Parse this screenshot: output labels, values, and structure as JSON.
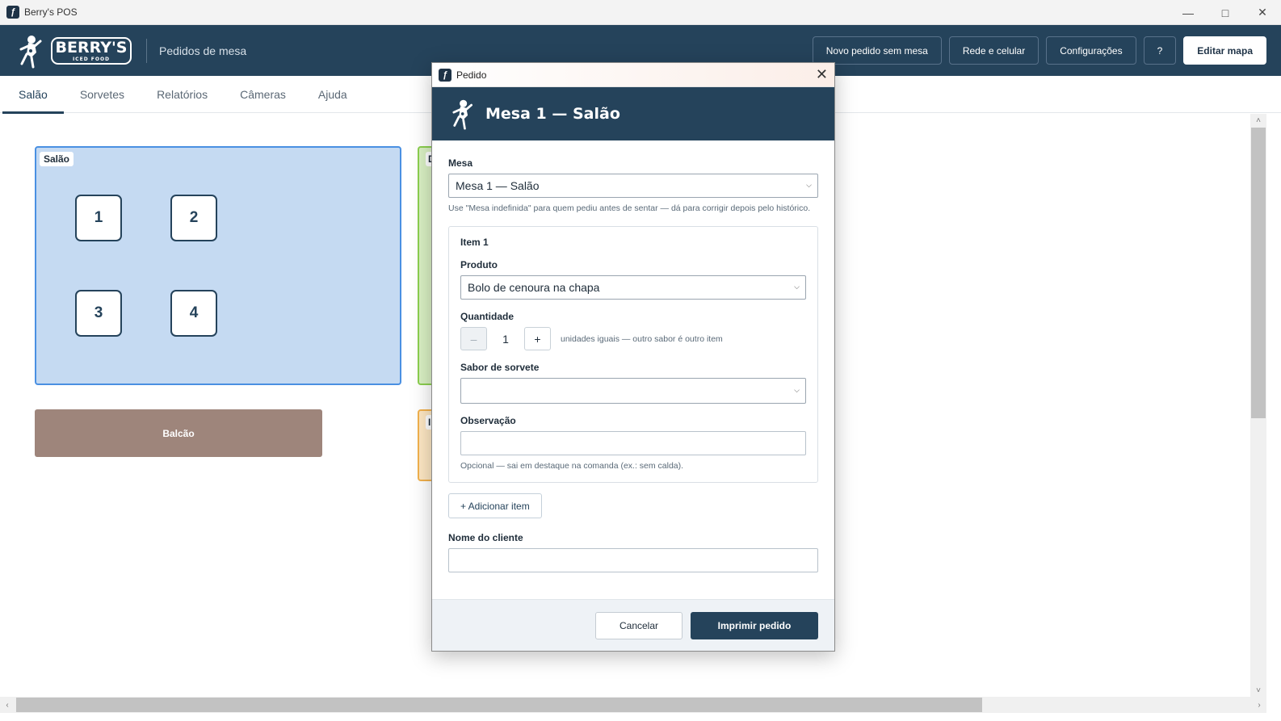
{
  "window": {
    "title": "Berry's POS"
  },
  "header": {
    "logo_text": "BERRY'S",
    "logo_sub": "ICED FOOD",
    "subtitle": "Pedidos de mesa",
    "actions": [
      "Novo pedido sem mesa",
      "Rede e celular",
      "Configurações",
      "?",
      "Editar mapa"
    ]
  },
  "tabs": [
    "Salão",
    "Sorvetes",
    "Relatórios",
    "Câmeras",
    "Ajuda"
  ],
  "map": {
    "zones": {
      "salao": "Salão",
      "green": "D",
      "orange": "I"
    },
    "tables": [
      "1",
      "2",
      "3",
      "4"
    ],
    "balcao": "Balcão"
  },
  "dialog": {
    "window_title": "Pedido",
    "heading": "Mesa 1 — Salão",
    "mesa_label": "Mesa",
    "mesa_value": "Mesa 1 — Salão",
    "mesa_hint": "Use \"Mesa indefinida\" para quem pediu antes de sentar — dá para corrigir depois pelo histórico.",
    "item": {
      "title": "Item 1",
      "produto_label": "Produto",
      "produto_value": "Bolo de cenoura na chapa",
      "quantidade_label": "Quantidade",
      "quantidade_value": "1",
      "quantidade_note": "unidades iguais — outro sabor é outro item",
      "sabor_label": "Sabor de sorvete",
      "sabor_value": "",
      "obs_label": "Observação",
      "obs_value": "",
      "obs_hint": "Opcional — sai em destaque na comanda (ex.: sem calda)."
    },
    "add_item": "+ Adicionar item",
    "cliente_label": "Nome do cliente",
    "cliente_value": "",
    "cancel": "Cancelar",
    "print": "Imprimir pedido"
  },
  "colors": {
    "header_bg": "#25435b",
    "salao_zone": "#c5daf2",
    "salao_border": "#4a90e2",
    "balcao": "#9e857b",
    "green_zone": "#d9f0c3",
    "orange_zone": "#fde7c3"
  },
  "icons": {
    "app": "berrys-app-icon",
    "mascot": "mascot-logo-icon",
    "close": "close-icon",
    "chevron": "chevron-down-icon"
  }
}
